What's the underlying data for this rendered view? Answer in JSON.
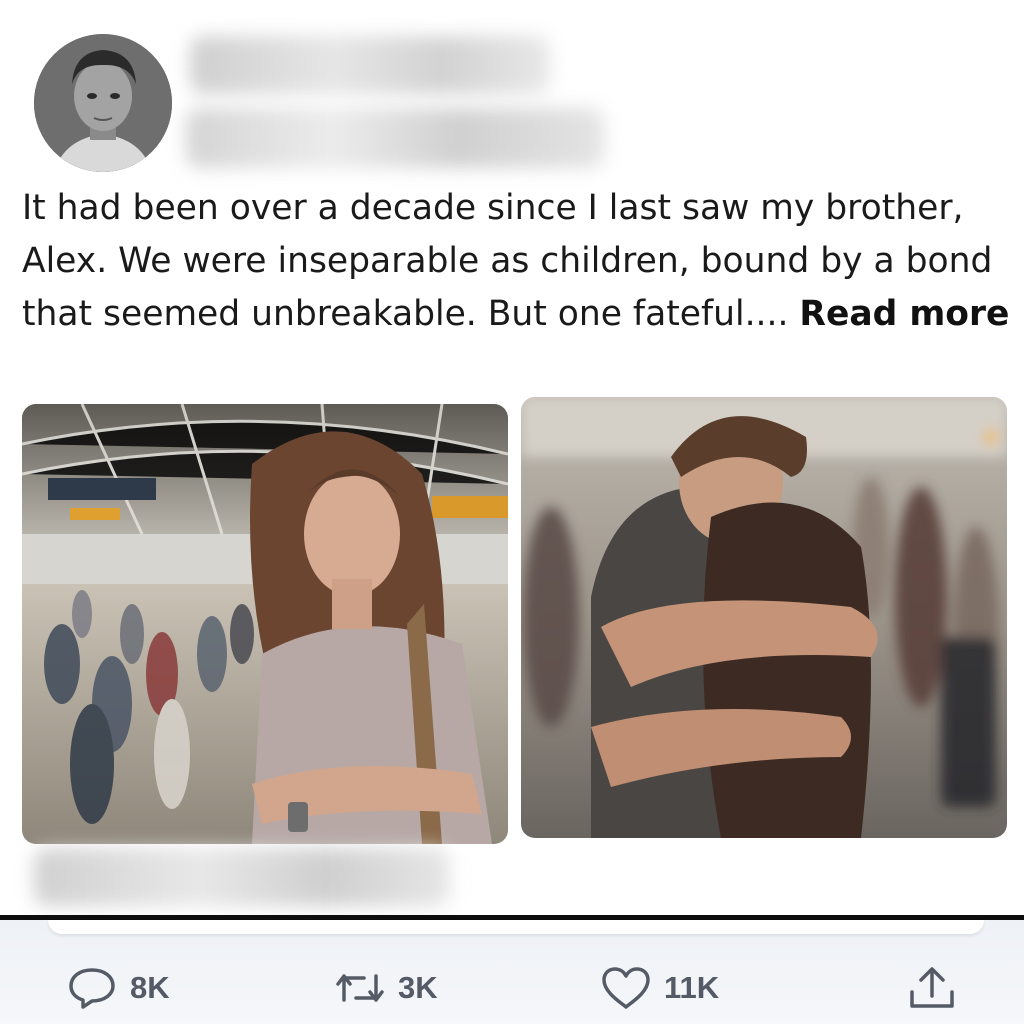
{
  "post": {
    "author_name": "",
    "author_handle": "",
    "text": "It had been over a decade since I last saw my brother, Alex. We were inseparable as children, bound by a bond that seemed unbreakable. But one fateful....",
    "read_more_label": "Read more",
    "images": [
      {
        "alt": "woman-waiting-in-airport"
      },
      {
        "alt": "siblings-hugging-in-airport"
      }
    ]
  },
  "actions": {
    "reply_count": "8K",
    "repost_count": "3K",
    "like_count": "11K"
  },
  "icons": {
    "reply": "speech-bubble-icon",
    "repost": "repost-arrows-icon",
    "like": "heart-icon",
    "share": "share-upload-icon"
  },
  "colors": {
    "icon_gray": "#555b66",
    "text": "#1a1a1a"
  }
}
